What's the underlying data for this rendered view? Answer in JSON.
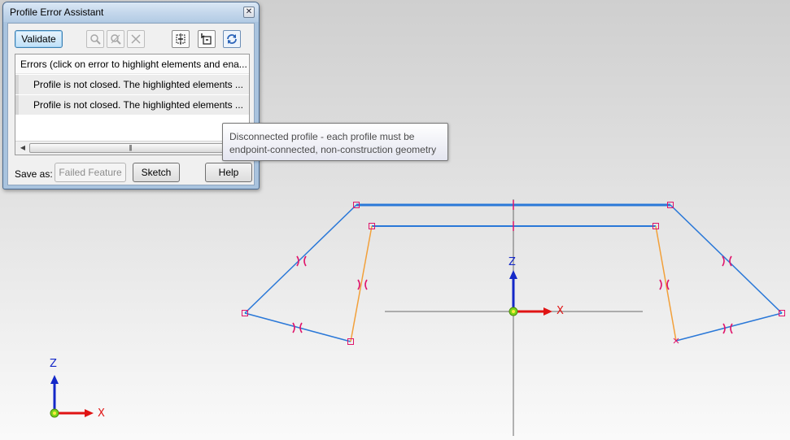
{
  "window": {
    "title": "Profile Error Assistant",
    "close_glyph": "✕"
  },
  "toolbar": {
    "validate_label": "Validate",
    "icons": [
      "zoom-icon",
      "zoom-selection-icon",
      "clear-icon",
      "fit-profile-icon",
      "select-profile-icon",
      "refresh-icon"
    ]
  },
  "error_list": {
    "header": "Errors (click on error to highlight elements and ena...",
    "rows": [
      "Profile is not closed.  The highlighted elements ...",
      "Profile is not closed.  The highlighted elements ..."
    ],
    "scroll_left": "◀",
    "scroll_right": "▶",
    "scroll_grip": "|||"
  },
  "footer": {
    "save_as_label": "Save as:",
    "failed_feature_label": "Failed Feature",
    "sketch_label": "Sketch",
    "help_label": "Help"
  },
  "tooltip": {
    "line1": "Disconnected profile - each profile must be",
    "line2": "endpoint-connected, non-construction geometry"
  },
  "axes": {
    "main_z": "Z",
    "main_x": "X",
    "corner_z": "Z",
    "corner_x": "X"
  },
  "colors": {
    "profile_blue": "#2a78d8",
    "profile_orange": "#f2a03a",
    "error_marker": "#e0156b",
    "axis_blue": "#1428c8",
    "axis_red": "#e01414",
    "origin_green": "#7cd619"
  }
}
